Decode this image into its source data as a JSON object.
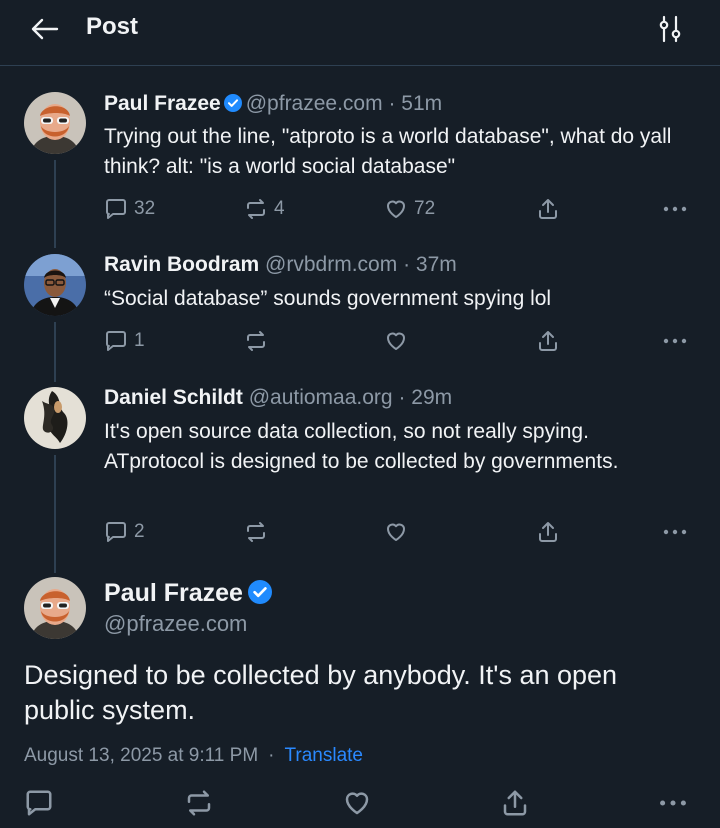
{
  "header": {
    "title": "Post"
  },
  "thread": [
    {
      "name": "Paul Frazee",
      "verified": true,
      "handle": "@pfrazee.com",
      "time": "· 51m",
      "text": "Trying out the line, \"atproto is a world database\", what do yall think? alt: \"is a world social database\"",
      "replies": "32",
      "reposts": "4",
      "likes": "72"
    },
    {
      "name": "Ravin Boodram",
      "verified": false,
      "handle": "@rvbdrm.com",
      "time": "· 37m",
      "text": "“Social database” sounds government spying lol",
      "replies": "1",
      "reposts": "",
      "likes": ""
    },
    {
      "name": "Daniel Schildt",
      "verified": false,
      "handle": "@autiomaa.org",
      "time": "· 29m",
      "text": "It's open source data collection, so not really spying. ATprotocol is designed to be collected by governments.",
      "replies": "2",
      "reposts": "",
      "likes": ""
    }
  ],
  "main_post": {
    "name": "Paul Frazee",
    "verified": true,
    "handle": "@pfrazee.com",
    "text": "Designed to be collected by anybody. It's an open public system.",
    "timestamp": "August 13, 2025 at 9:11 PM",
    "separator": "·",
    "translate_label": "Translate"
  },
  "colors": {
    "background": "#161e27",
    "border": "#2e4052",
    "muted": "#8d99a6",
    "link": "#2a89ff",
    "verified": "#208bfe"
  },
  "icons": {
    "back": "arrow-left-icon",
    "filter": "sliders-icon",
    "reply": "speech-bubble-icon",
    "repost": "repost-icon",
    "like": "heart-icon",
    "share": "share-icon",
    "more": "ellipsis-icon"
  }
}
